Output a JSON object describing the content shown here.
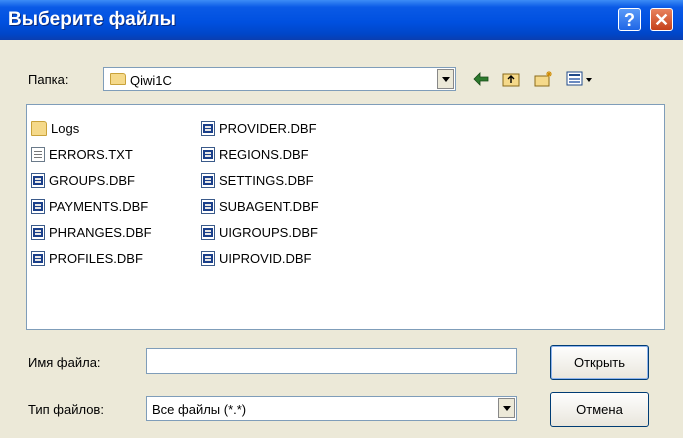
{
  "window": {
    "title": "Выберите файлы"
  },
  "toolbar": {
    "folder_label": "Папка:",
    "folder_value": "Qiwi1C"
  },
  "files": {
    "col1": [
      "Logs",
      "ERRORS.TXT",
      "GROUPS.DBF",
      "PAYMENTS.DBF",
      "PHRANGES.DBF",
      "PROFILES.DBF"
    ],
    "col2": [
      "PROVIDER.DBF",
      "REGIONS.DBF",
      "SETTINGS.DBF",
      "SUBAGENT.DBF",
      "UIGROUPS.DBF",
      "UIPROVID.DBF"
    ]
  },
  "filename": {
    "label": "Имя файла:",
    "value": ""
  },
  "filetype": {
    "label": "Тип файлов:",
    "value": "Все файлы (*.*)"
  },
  "buttons": {
    "open": "Открыть",
    "cancel": "Отмена"
  },
  "icons": [
    "help-icon",
    "close-icon",
    "folder-icon",
    "back-arrow-icon",
    "up-folder-icon",
    "new-folder-icon",
    "view-menu-icon",
    "dbf-file-icon",
    "text-file-icon"
  ]
}
